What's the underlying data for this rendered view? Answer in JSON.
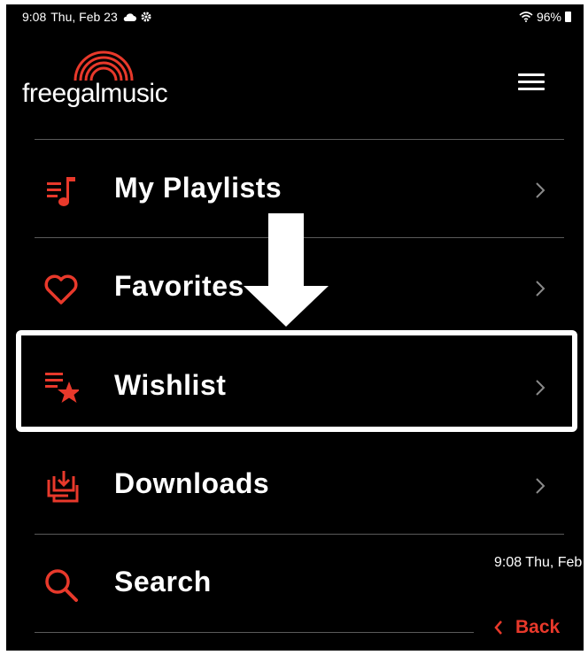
{
  "status_bar": {
    "time": "9:08",
    "date": "Thu, Feb 23",
    "battery": "96%"
  },
  "brand": {
    "logo_text": "freegalmusic"
  },
  "menu": {
    "items": [
      {
        "label": "My Playlists",
        "icon": "playlist-icon"
      },
      {
        "label": "Favorites",
        "icon": "heart-icon"
      },
      {
        "label": "Wishlist",
        "icon": "wishlist-star-icon"
      },
      {
        "label": "Downloads",
        "icon": "download-icon"
      },
      {
        "label": "Search",
        "icon": "search-icon"
      }
    ]
  },
  "overlay": {
    "status_text": "9:08  Thu, Feb",
    "back_label": "Back"
  },
  "colors": {
    "accent": "#e8392b",
    "background": "#000000",
    "text": "#ffffff",
    "divider": "#5a5a5a"
  }
}
